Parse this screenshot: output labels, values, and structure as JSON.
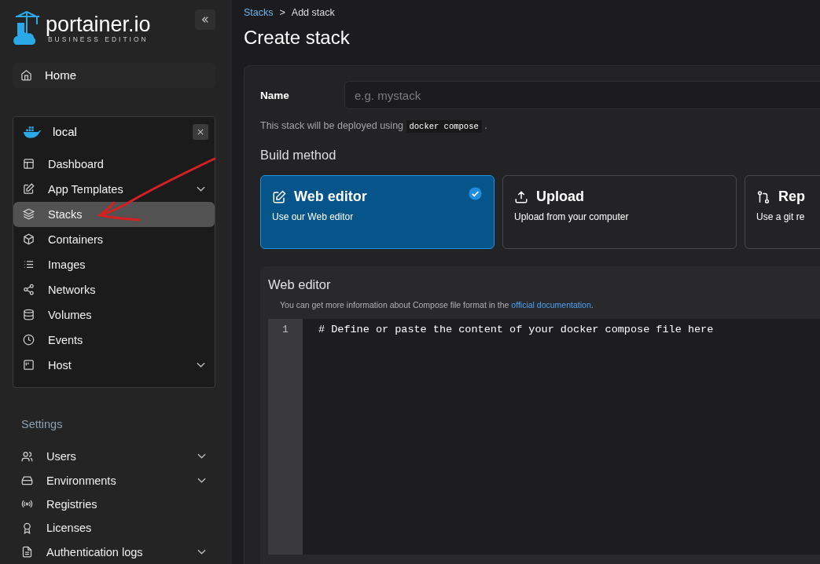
{
  "sidebar": {
    "logo": {
      "name": "portainer.io",
      "edition": "BUSINESS EDITION"
    },
    "home": {
      "label": "Home"
    },
    "environment": {
      "name": "local",
      "items": [
        {
          "label": "Dashboard",
          "expandable": false,
          "selected": false
        },
        {
          "label": "App Templates",
          "expandable": true,
          "selected": false
        },
        {
          "label": "Stacks",
          "expandable": false,
          "selected": true
        },
        {
          "label": "Containers",
          "expandable": false,
          "selected": false
        },
        {
          "label": "Images",
          "expandable": false,
          "selected": false
        },
        {
          "label": "Networks",
          "expandable": false,
          "selected": false
        },
        {
          "label": "Volumes",
          "expandable": false,
          "selected": false
        },
        {
          "label": "Events",
          "expandable": false,
          "selected": false
        },
        {
          "label": "Host",
          "expandable": true,
          "selected": false
        }
      ]
    },
    "settings": {
      "title": "Settings",
      "items": [
        {
          "label": "Users",
          "expandable": true
        },
        {
          "label": "Environments",
          "expandable": true
        },
        {
          "label": "Registries",
          "expandable": false
        },
        {
          "label": "Licenses",
          "expandable": false
        },
        {
          "label": "Authentication logs",
          "expandable": true
        }
      ]
    }
  },
  "breadcrumb": [
    {
      "label": "Stacks",
      "link": true
    },
    {
      "label": ">",
      "link": false
    },
    {
      "label": "Add stack",
      "link": false
    }
  ],
  "page_title": "Create stack",
  "form": {
    "name_label": "Name",
    "name_placeholder": "e.g. mystack",
    "deploy_note": {
      "text": "This stack will be deployed using",
      "code": "docker compose",
      "end": "."
    },
    "build_method_title": "Build method",
    "methods": [
      {
        "title": "Web editor",
        "description": "Use our Web editor",
        "selected": true
      },
      {
        "title": "Upload",
        "description": "Upload from your computer",
        "selected": false
      },
      {
        "title": "Rep",
        "description": "Use a git re",
        "selected": false
      }
    ],
    "editor": {
      "title": "Web editor",
      "note": "You can get more information about Compose file format in the",
      "link": "official documentation",
      "note_end": ".",
      "lines": [
        {
          "number": "1",
          "text": "# Define or paste the content of your docker compose file here"
        }
      ]
    }
  },
  "annotation": {
    "kind": "arrow"
  }
}
